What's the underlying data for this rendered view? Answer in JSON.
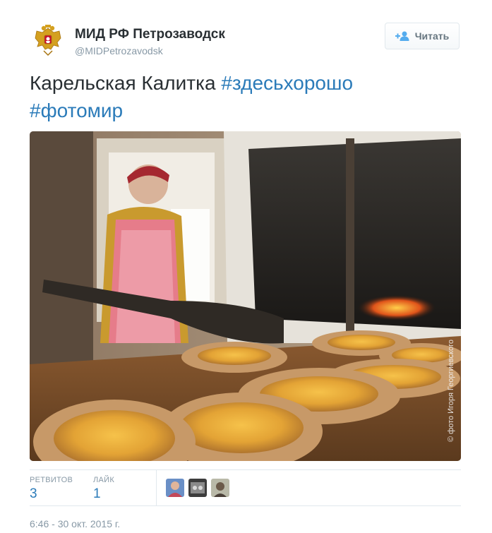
{
  "account": {
    "name": "МИД РФ Петрозаводск",
    "handle": "@MIDPetrozavodsk",
    "avatar_icon": "russian-coat-of-arms-icon"
  },
  "follow_button": {
    "label": "Читать",
    "icon": "add-user-icon"
  },
  "tweet": {
    "text": "Карельская Калитка",
    "hashtags": [
      "#здесьхорошо",
      "#фотомир"
    ]
  },
  "photo": {
    "watermark": "© фото Игоря Георгиевского"
  },
  "stats": {
    "retweets_label": "РЕТВИТОВ",
    "retweets_value": "3",
    "likes_label": "ЛАЙК",
    "likes_value": "1"
  },
  "timestamp": "6:46 - 30 окт. 2015 г.",
  "colors": {
    "link": "#2b7bb9",
    "muted": "#8899a6",
    "text": "#292f33",
    "border": "#e1e8ed"
  }
}
